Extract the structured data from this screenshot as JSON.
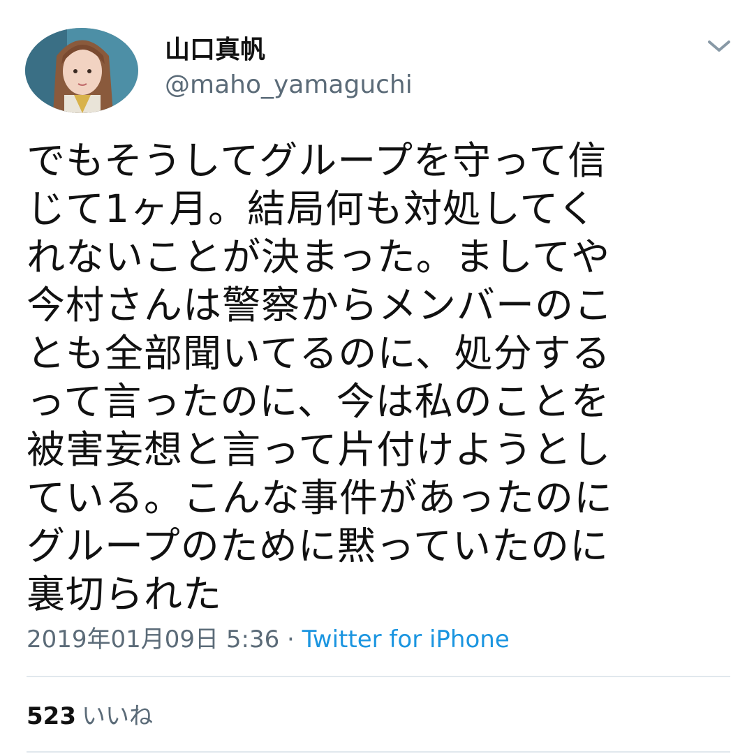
{
  "tweet": {
    "author": {
      "display_name": "山口真帆",
      "handle": "@maho_yamaguchi"
    },
    "text_lines": [
      "でもそうしてグループを守って信",
      "じて1ヶ月。結局何も対処してく",
      "れないことが決まった。ましてや",
      "今村さんは警察からメンバーのこ",
      "とも全部聞いてるのに、処分する",
      "って言ったのに、今は私のことを",
      "被害妄想と言って片付けようとし",
      "ている。こんな事件があったのに",
      "グループのために黙っていたのに",
      "裏切られた"
    ],
    "timestamp": "2019年01月09日 5:36",
    "separator": "·",
    "source": "Twitter for iPhone",
    "likes": {
      "count": "523",
      "label": "いいね"
    }
  },
  "icons": {
    "menu": "chevron-down-icon",
    "avatar": "user-avatar-photo"
  },
  "colors": {
    "text": "#111111",
    "secondary": "#5b6b78",
    "link": "#1b95e0",
    "divider": "#e1e8ed"
  }
}
